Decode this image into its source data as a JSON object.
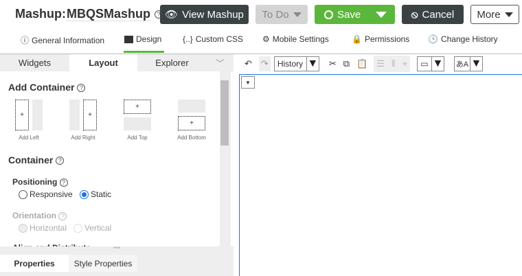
{
  "header": {
    "label": "Mashup:",
    "name": "MBQSMashup",
    "help": "?"
  },
  "buttons": {
    "view": "View Mashup",
    "todo": "To Do",
    "save": "Save",
    "cancel": "Cancel",
    "more": "More"
  },
  "nav": [
    {
      "label": "General Information"
    },
    {
      "label": "Design"
    },
    {
      "label": "Custom CSS"
    },
    {
      "label": "Mobile Settings"
    },
    {
      "label": "Permissions"
    },
    {
      "label": "Change History"
    }
  ],
  "panel_tabs": [
    "Widgets",
    "Layout",
    "Explorer"
  ],
  "toolbar": {
    "history": "History"
  },
  "layout": {
    "add_container": "Add Container",
    "options": [
      "Add Left",
      "Add Right",
      "Add Top",
      "Add Bottom"
    ],
    "container": "Container",
    "positioning": "Positioning",
    "responsive": "Responsive",
    "static": "Static",
    "orientation": "Orientation",
    "horizontal": "Horizontal",
    "vertical": "Vertical",
    "align": "Align and Distribute"
  },
  "bottom_tabs": [
    "Properties",
    "Style Properties"
  ],
  "colors": {
    "green": "#5bb73b",
    "dark": "#3b4243",
    "blue": "#1a73e8"
  }
}
